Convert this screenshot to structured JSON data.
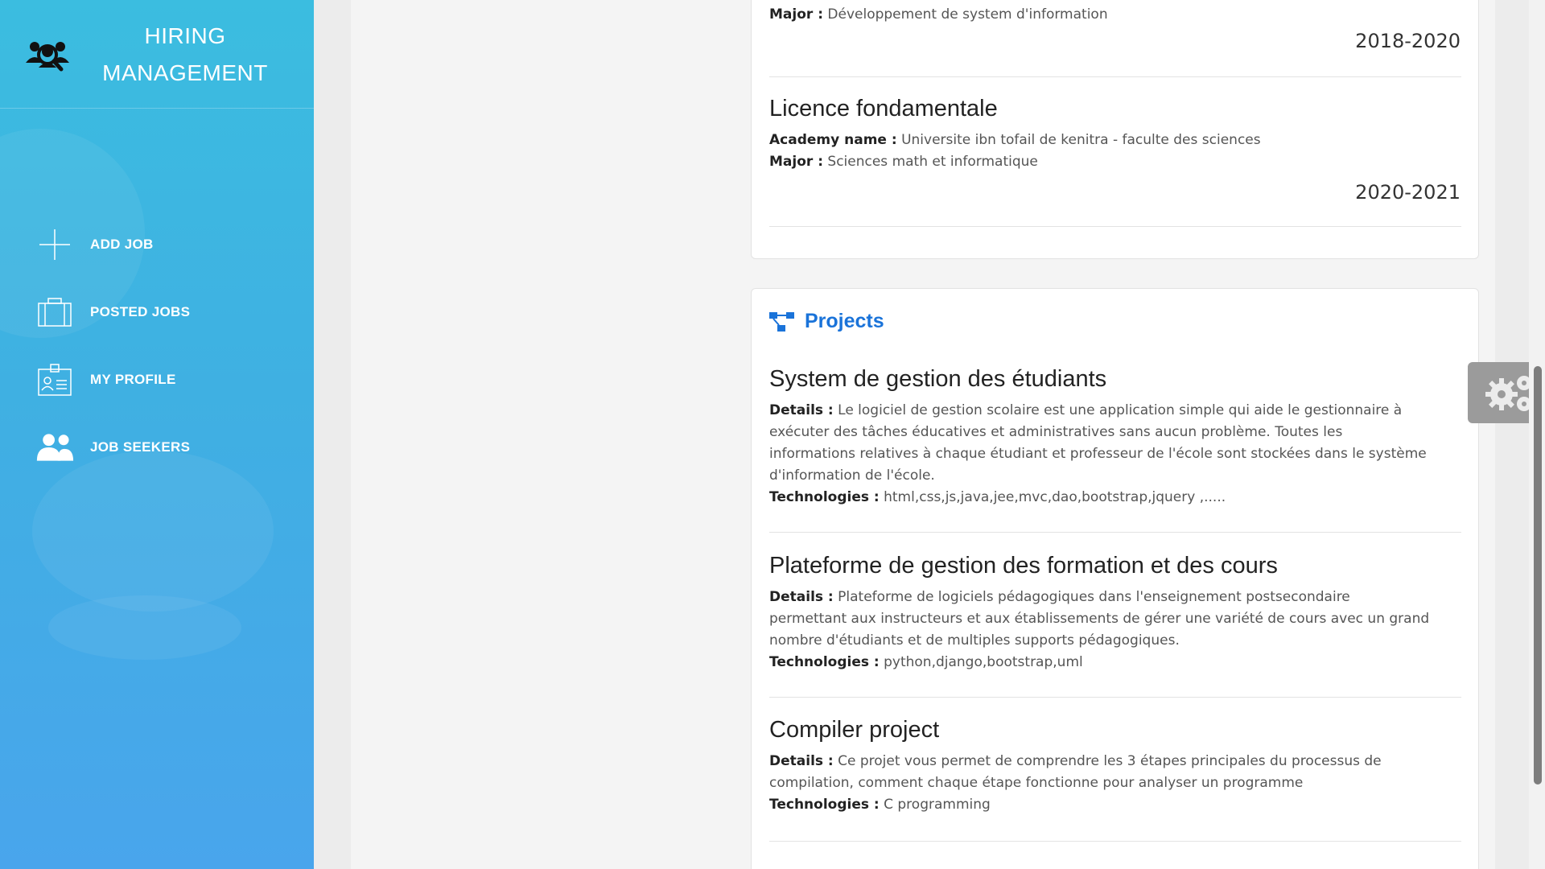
{
  "app": {
    "brand_line1": "HIRING",
    "brand_line2": "MANAGEMENT"
  },
  "sidebar": {
    "items": [
      {
        "label": "ADD JOB",
        "icon": "plus-icon"
      },
      {
        "label": "POSTED JOBS",
        "icon": "briefcase-icon"
      },
      {
        "label": "MY PROFILE",
        "icon": "id-card-icon"
      },
      {
        "label": "JOB SEEKERS",
        "icon": "users-icon"
      }
    ]
  },
  "education": {
    "entries": [
      {
        "major_label": "Major :",
        "major": "Développement de system d'information",
        "years": "2018-2020"
      },
      {
        "title": "Licence fondamentale",
        "academy_label": "Academy name :",
        "academy": "Universite ibn tofail de kenitra - faculte des sciences",
        "major_label": "Major :",
        "major": "Sciences math et informatique",
        "years": "2020-2021"
      }
    ]
  },
  "projects": {
    "heading": "Projects",
    "details_label": "Details :",
    "tech_label": "Technologies :",
    "items": [
      {
        "title": "System de gestion des étudiants",
        "details_l1": "Le logiciel de gestion scolaire est une application simple qui aide le gestionnaire à",
        "details_l2": "exécuter des tâches éducatives et administratives sans aucun problème. Toutes les",
        "details_l3": "informations relatives à chaque étudiant et professeur de l'école sont stockées dans le système",
        "details_l4": "d'information de l'école.",
        "technologies": "html,css,js,java,jee,mvc,dao,bootstrap,jquery ,....."
      },
      {
        "title": "Plateforme de gestion des formation et des cours",
        "details_l1": "Plateforme de logiciels pédagogiques dans l'enseignement postsecondaire",
        "details_l2": "permettant aux instructeurs et aux établissements de gérer une variété de cours avec un grand",
        "details_l3": "nombre d'étudiants et de multiples supports pédagogiques.",
        "technologies": "python,django,bootstrap,uml"
      },
      {
        "title": "Compiler project",
        "details_l1": "Ce projet vous permet de comprendre les 3 étapes principales du processus de",
        "details_l2": "compilation, comment chaque étape fonctionne pour analyser un programme",
        "technologies": "C programming"
      }
    ]
  },
  "colors": {
    "accent": "#1a73d9",
    "sidebar_top": "#3bbde0",
    "sidebar_bottom": "#49a5ec"
  }
}
